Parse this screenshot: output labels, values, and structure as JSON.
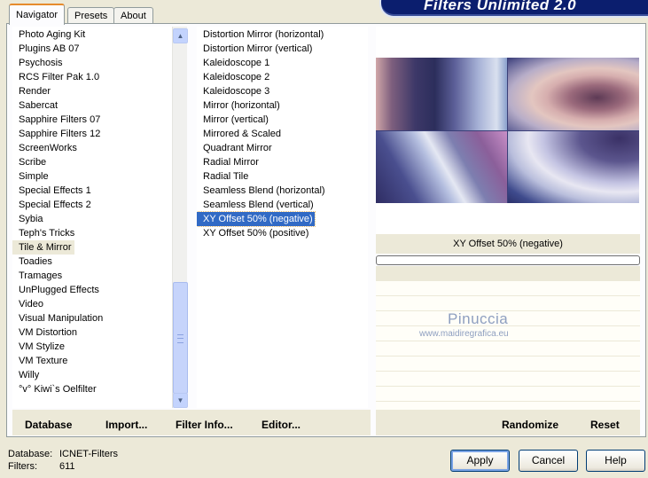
{
  "header": {
    "title": "Filters Unlimited 2.0"
  },
  "tabs": [
    {
      "label": "Navigator",
      "active": true
    },
    {
      "label": "Presets",
      "active": false
    },
    {
      "label": "About",
      "active": false
    }
  ],
  "categories": [
    "Photo Aging Kit",
    "Plugins AB 07",
    "Psychosis",
    "RCS Filter Pak 1.0",
    "Render",
    "Sabercat",
    "Sapphire Filters 07",
    "Sapphire Filters 12",
    "ScreenWorks",
    "Scribe",
    "Simple",
    "Special Effects 1",
    "Special Effects 2",
    "Sybia",
    "Teph's Tricks",
    "Tile & Mirror",
    "Toadies",
    "Tramages",
    "UnPlugged Effects",
    "Video",
    "Visual Manipulation",
    "VM Distortion",
    "VM Stylize",
    "VM Texture",
    "Willy",
    "°v° Kiwi`s Oelfilter"
  ],
  "selected_category": "Tile & Mirror",
  "filters": [
    "Distortion Mirror (horizontal)",
    "Distortion Mirror (vertical)",
    "Kaleidoscope 1",
    "Kaleidoscope 2",
    "Kaleidoscope 3",
    "Mirror (horizontal)",
    "Mirror (vertical)",
    "Mirrored & Scaled",
    "Quadrant Mirror",
    "Radial Mirror",
    "Radial Tile",
    "Seamless Blend (horizontal)",
    "Seamless Blend (vertical)",
    "XY Offset 50% (negative)",
    "XY Offset 50% (positive)"
  ],
  "selected_filter": "XY Offset 50% (negative)",
  "preview": {
    "filter_name": "XY Offset 50% (negative)",
    "watermark": "Pinuccia",
    "watermark_url": "www.maidiregrafica.eu"
  },
  "links": {
    "database": "Database",
    "import": "Import...",
    "filter_info": "Filter Info...",
    "editor": "Editor...",
    "randomize": "Randomize",
    "reset": "Reset"
  },
  "status": {
    "database_label": "Database:",
    "database_value": "ICNET-Filters",
    "filters_label": "Filters:",
    "filters_value": "611"
  },
  "buttons": {
    "apply": "Apply",
    "cancel": "Cancel",
    "help": "Help"
  },
  "colors": {
    "selection": "#316ac5",
    "banner": "#0b1e6e",
    "window_bg": "#ece9d8"
  }
}
